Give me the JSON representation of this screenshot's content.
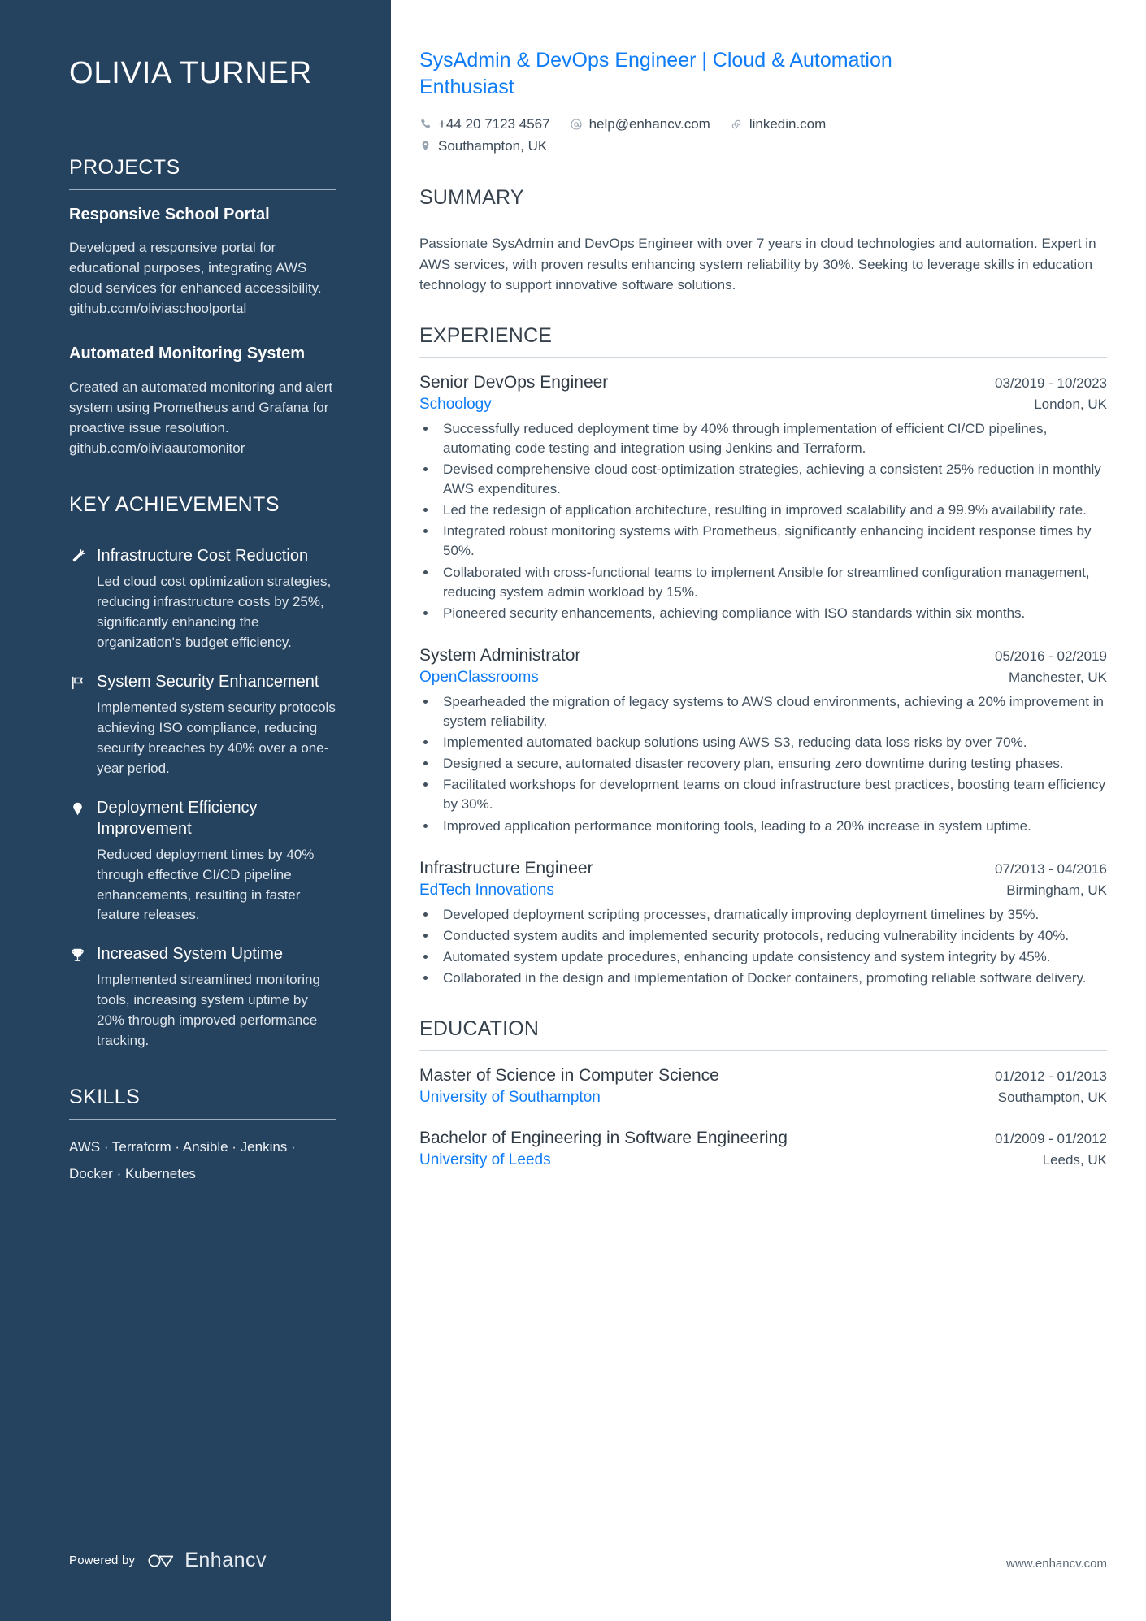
{
  "colors": {
    "sidebar_bg": "#25425f",
    "accent_blue": "#0f7cf7",
    "body_text": "#41505e"
  },
  "sidebar": {
    "name": "OLIVIA TURNER",
    "projects": {
      "heading": "PROJECTS",
      "items": [
        {
          "title": "Responsive School Portal",
          "description": "Developed a responsive portal for educational purposes, integrating AWS cloud services for enhanced accessibility.",
          "link": "github.com/oliviaschoolportal"
        },
        {
          "title": "Automated Monitoring System",
          "description": "Created an automated monitoring and alert system using Prometheus and Grafana for proactive issue resolution.",
          "link": "github.com/oliviaautomonitor"
        }
      ]
    },
    "achievements": {
      "heading": "KEY ACHIEVEMENTS",
      "items": [
        {
          "icon": "magic-wand-icon",
          "title": "Infrastructure Cost Reduction",
          "description": "Led cloud cost optimization strategies, reducing infrastructure costs by 25%, significantly enhancing the organization's budget efficiency."
        },
        {
          "icon": "flag-icon",
          "title": "System Security Enhancement",
          "description": "Implemented system security protocols achieving ISO compliance, reducing security breaches by 40% over a one-year period."
        },
        {
          "icon": "pin-icon",
          "title": "Deployment Efficiency Improvement",
          "description": "Reduced deployment times by 40% through effective CI/CD pipeline enhancements, resulting in faster feature releases."
        },
        {
          "icon": "trophy-icon",
          "title": "Increased System Uptime",
          "description": "Implemented streamlined monitoring tools, increasing system uptime by 20% through improved performance tracking."
        }
      ]
    },
    "skills": {
      "heading": "SKILLS",
      "line1": "AWS · Terraform · Ansible · Jenkins ·",
      "line2": "Docker · Kubernetes"
    },
    "footer": {
      "powered_by": "Powered by",
      "brand": "Enhancv"
    }
  },
  "main": {
    "headline": "SysAdmin & DevOps Engineer | Cloud & Automation Enthusiast",
    "contacts": {
      "phone": "+44 20 7123 4567",
      "email": "help@enhancv.com",
      "linkedin": "linkedin.com",
      "location": "Southampton, UK"
    },
    "summary": {
      "heading": "SUMMARY",
      "text": "Passionate SysAdmin and DevOps Engineer with over 7 years in cloud technologies and automation. Expert in AWS services, with proven results enhancing system reliability by 30%. Seeking to leverage skills in education technology to support innovative software solutions."
    },
    "experience": {
      "heading": "EXPERIENCE",
      "jobs": [
        {
          "title": "Senior DevOps Engineer",
          "dates": "03/2019 - 10/2023",
          "company": "Schoology",
          "location": "London, UK",
          "bullets": [
            "Successfully reduced deployment time by 40% through implementation of efficient CI/CD pipelines, automating code testing and integration using Jenkins and Terraform.",
            "Devised comprehensive cloud cost-optimization strategies, achieving a consistent 25% reduction in monthly AWS expenditures.",
            "Led the redesign of application architecture, resulting in improved scalability and a 99.9% availability rate.",
            "Integrated robust monitoring systems with Prometheus, significantly enhancing incident response times by 50%.",
            "Collaborated with cross-functional teams to implement Ansible for streamlined configuration management, reducing system admin workload by 15%.",
            "Pioneered security enhancements, achieving compliance with ISO standards within six months."
          ]
        },
        {
          "title": "System Administrator",
          "dates": "05/2016 - 02/2019",
          "company": "OpenClassrooms",
          "location": "Manchester, UK",
          "bullets": [
            "Spearheaded the migration of legacy systems to AWS cloud environments, achieving a 20% improvement in system reliability.",
            "Implemented automated backup solutions using AWS S3, reducing data loss risks by over 70%.",
            "Designed a secure, automated disaster recovery plan, ensuring zero downtime during testing phases.",
            "Facilitated workshops for development teams on cloud infrastructure best practices, boosting team efficiency by 30%.",
            "Improved application performance monitoring tools, leading to a 20% increase in system uptime."
          ]
        },
        {
          "title": "Infrastructure Engineer",
          "dates": "07/2013 - 04/2016",
          "company": "EdTech Innovations",
          "location": "Birmingham, UK",
          "bullets": [
            "Developed deployment scripting processes, dramatically improving deployment timelines by 35%.",
            "Conducted system audits and implemented security protocols, reducing vulnerability incidents by 40%.",
            "Automated system update procedures, enhancing update consistency and system integrity by 45%.",
            "Collaborated in the design and implementation of Docker containers, promoting reliable software delivery."
          ]
        }
      ]
    },
    "education": {
      "heading": "EDUCATION",
      "items": [
        {
          "degree": "Master of Science in Computer Science",
          "dates": "01/2012 - 01/2013",
          "school": "University of Southampton",
          "location": "Southampton, UK"
        },
        {
          "degree": "Bachelor of Engineering in Software Engineering",
          "dates": "01/2009 - 01/2012",
          "school": "University of Leeds",
          "location": "Leeds, UK"
        }
      ]
    },
    "site_url": "www.enhancv.com"
  }
}
